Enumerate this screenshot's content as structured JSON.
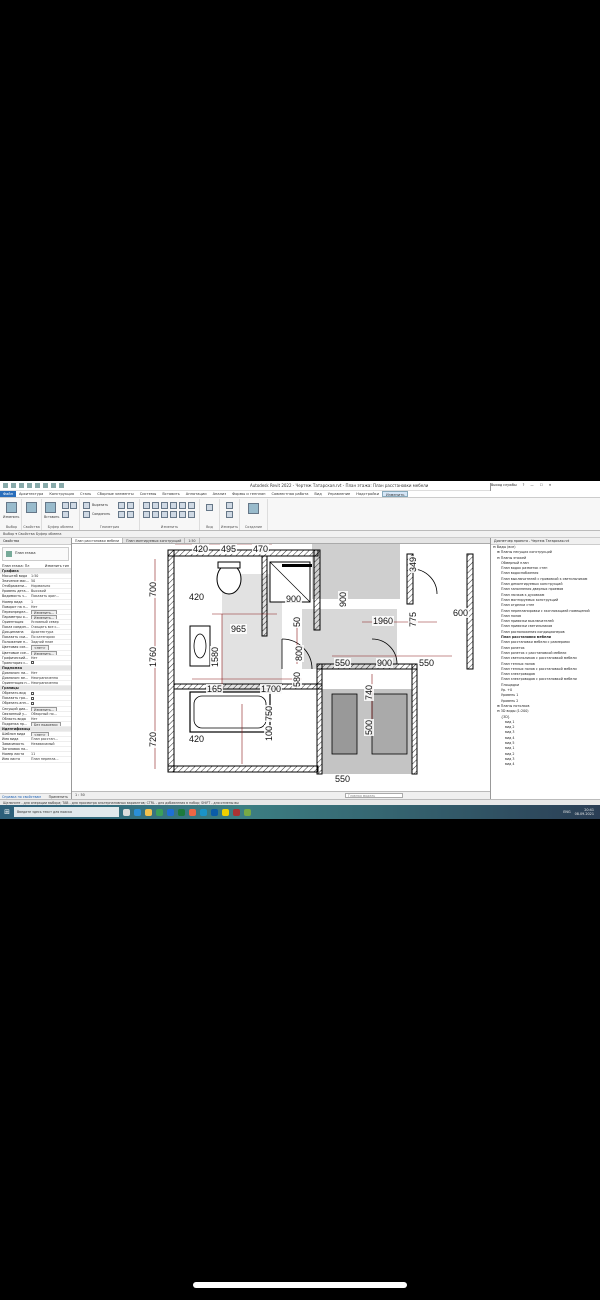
{
  "window": {
    "title": "Autodesk Revit 2022 - Чертеж Татарская.rvt - План этажа: План расстановки мебели",
    "signin": "Выход службы",
    "help": "?"
  },
  "ribbon_tabs": [
    "Файл",
    "Архитектура",
    "Конструкция",
    "Сталь",
    "Сборные элементы",
    "Системы",
    "Вставить",
    "Аннотации",
    "Анализ",
    "Формы и генплан",
    "Совместная работа",
    "Вид",
    "Управление",
    "Надстройки",
    "Изменить"
  ],
  "active_tab": "Изменить",
  "ribbon_groups": [
    "Выбор",
    "Свойства",
    "Буфер обмена",
    "Геометрия",
    "Изменить",
    "Вид",
    "Измерить",
    "Создание"
  ],
  "ribbon_buttons": {
    "modify": "Изменить",
    "cut": "Вырезать",
    "join": "Соединить",
    "paste": "Вставить"
  },
  "second_bar": "Выбор ▾   Свойства   Буфер обмена",
  "properties": {
    "header": "Свойства",
    "type_name": "План этажа",
    "selector": "План этажа: Пл",
    "edit_type": "Изменить тип",
    "rows": [
      {
        "k": "Графика",
        "v": "",
        "kind": "sect"
      },
      {
        "k": "Масштаб вида",
        "v": "1:50"
      },
      {
        "k": "Значение мас...",
        "v": "50"
      },
      {
        "k": "Отображени...",
        "v": "Нормально"
      },
      {
        "k": "Уровень дета...",
        "v": "Высокий"
      },
      {
        "k": "Видимость ч...",
        "v": "Показать ориг..."
      },
      {
        "k": "Номер вида",
        "v": "1"
      },
      {
        "k": "Поворот на л...",
        "v": "Нет"
      },
      {
        "k": "Переопредел...",
        "v": "Изменить...",
        "kind": "btn"
      },
      {
        "k": "Параметры о...",
        "v": "Изменить...",
        "kind": "btn"
      },
      {
        "k": "Ориентация",
        "v": "Условный север"
      },
      {
        "k": "Показ соедин...",
        "v": "Очищать все с..."
      },
      {
        "k": "Дисциплина",
        "v": "Архитектура"
      },
      {
        "k": "Показать ски...",
        "v": "По категории"
      },
      {
        "k": "Положение п...",
        "v": "Задний план"
      },
      {
        "k": "Цветовая схе...",
        "v": "<нет>",
        "kind": "btn"
      },
      {
        "k": "Цветовые схе...",
        "v": "Изменить...",
        "kind": "btn"
      },
      {
        "k": "Графический...",
        "v": "Нет"
      },
      {
        "k": "Траектория с...",
        "v": "",
        "kind": "cb"
      },
      {
        "k": "Подложка",
        "v": "",
        "kind": "sect"
      },
      {
        "k": "Диапазон: ни...",
        "v": "Нет"
      },
      {
        "k": "Диапазон: ве...",
        "v": "Неограниченно"
      },
      {
        "k": "Ориентация п...",
        "v": "Неограниченно"
      },
      {
        "k": "Границы",
        "v": "",
        "kind": "sect"
      },
      {
        "k": "Обрезать вид",
        "v": "",
        "kind": "cb"
      },
      {
        "k": "Показать гра...",
        "v": "",
        "kind": "cb"
      },
      {
        "k": "Обрезать анн...",
        "v": "",
        "kind": "cb"
      },
      {
        "k": "Секущий диа...",
        "v": "Изменить...",
        "kind": "btn"
      },
      {
        "k": "Связанный у...",
        "v": "Обзорный по..."
      },
      {
        "k": "Область вида",
        "v": "Нет"
      },
      {
        "k": "Подрезка пр...",
        "v": "Без подрезки",
        "kind": "btn"
      },
      {
        "k": "Идентификация",
        "v": "",
        "kind": "sect"
      },
      {
        "k": "Шаблон вида",
        "v": "<нет>",
        "kind": "btn"
      },
      {
        "k": "Имя вида",
        "v": "План расстан..."
      },
      {
        "k": "Зависимость",
        "v": "Независимый"
      },
      {
        "k": "Заголовок на...",
        "v": ""
      },
      {
        "k": "Номер листа",
        "v": "11"
      },
      {
        "k": "Имя листа",
        "v": "План перепла..."
      }
    ],
    "help_link": "Справка по свойствам",
    "apply": "Применить"
  },
  "doc_tabs": [
    "План расстановки мебели",
    "План монтируемых конструкций",
    "1:50"
  ],
  "drawing": {
    "dimensions": [
      "420",
      "495",
      "470",
      "700",
      "420",
      "900",
      "349",
      "900",
      "775",
      "600",
      "965",
      "50",
      "1960",
      "1760",
      "1580",
      "800",
      "550",
      "900",
      "550",
      "165",
      "1700",
      "580",
      "740",
      "500",
      "720",
      "420",
      "750",
      "100",
      "550"
    ]
  },
  "view_bar": {
    "scale": "1 : 50",
    "search": "Главная модель"
  },
  "browser": {
    "header": "Диспетчер проекта - Чертеж Татарская.rvt",
    "items": [
      {
        "t": "⊟ Виды (все)",
        "lvl": 0,
        "bold": false
      },
      {
        "t": "⊞ Планы несущих конструкций",
        "lvl": 1
      },
      {
        "t": "⊟ Планы этажей",
        "lvl": 1
      },
      {
        "t": "Обмерный план",
        "lvl": 2
      },
      {
        "t": "План водок разметок стен",
        "lvl": 2
      },
      {
        "t": "План водоснабжения",
        "lvl": 2
      },
      {
        "t": "План выключателей с привязкой к светильникам",
        "lvl": 2
      },
      {
        "t": "План демонтируемых конструкций",
        "lvl": 2
      },
      {
        "t": "План заполнения дверных проемов",
        "lvl": 2
      },
      {
        "t": "План лючков к духовкам",
        "lvl": 2
      },
      {
        "t": "План монтируемых конструкций",
        "lvl": 2
      },
      {
        "t": "План отделки стен",
        "lvl": 2
      },
      {
        "t": "План перепланировки с экспликацией помещений",
        "lvl": 2
      },
      {
        "t": "План полов",
        "lvl": 2
      },
      {
        "t": "План привязки выключателей",
        "lvl": 2
      },
      {
        "t": "План привязки светильников",
        "lvl": 2
      },
      {
        "t": "План расположения кондиционеров",
        "lvl": 2
      },
      {
        "t": "План расстановки мебели",
        "lvl": 2,
        "bold": true
      },
      {
        "t": "План расстановки мебели с размерами",
        "lvl": 2
      },
      {
        "t": "План розеток",
        "lvl": 2
      },
      {
        "t": "План розеток с расстановкой мебели",
        "lvl": 2
      },
      {
        "t": "План светильников с расстановкой мебели",
        "lvl": 2
      },
      {
        "t": "План теплых полов",
        "lvl": 2
      },
      {
        "t": "План теплых полов с расстановкой мебели",
        "lvl": 2
      },
      {
        "t": "План электроводов",
        "lvl": 2
      },
      {
        "t": "План электроводов с расстановкой мебели",
        "lvl": 2
      },
      {
        "t": "Площадки",
        "lvl": 2
      },
      {
        "t": "Ур. +0",
        "lvl": 2
      },
      {
        "t": "Уровень 1",
        "lvl": 2
      },
      {
        "t": "Уровень 2",
        "lvl": 2
      },
      {
        "t": "⊞ Планы потолков",
        "lvl": 1
      },
      {
        "t": "⊟ 3D виды (1:200)",
        "lvl": 1
      },
      {
        "t": "{3D}",
        "lvl": 2
      },
      {
        "t": "вид 1",
        "lvl": 3
      },
      {
        "t": "вид 2",
        "lvl": 3
      },
      {
        "t": "вид 3",
        "lvl": 3
      },
      {
        "t": "вид 4",
        "lvl": 3
      },
      {
        "t": "вид 5",
        "lvl": 3
      },
      {
        "t": "вид 1",
        "lvl": 3
      },
      {
        "t": "вид 2",
        "lvl": 3
      },
      {
        "t": "вид 3",
        "lvl": 3
      },
      {
        "t": "вид 4",
        "lvl": 3
      }
    ]
  },
  "status_text": "Щелкните - для операции выбора; TAB - для просмотра альтернативных вариантов; CTRL - для добавления в набор; SHIFT - для отмены вы",
  "taskbar": {
    "search_placeholder": "Введите здесь текст для поиска",
    "lang": "ENG",
    "time": "20:41",
    "date": "08.09.2021"
  }
}
